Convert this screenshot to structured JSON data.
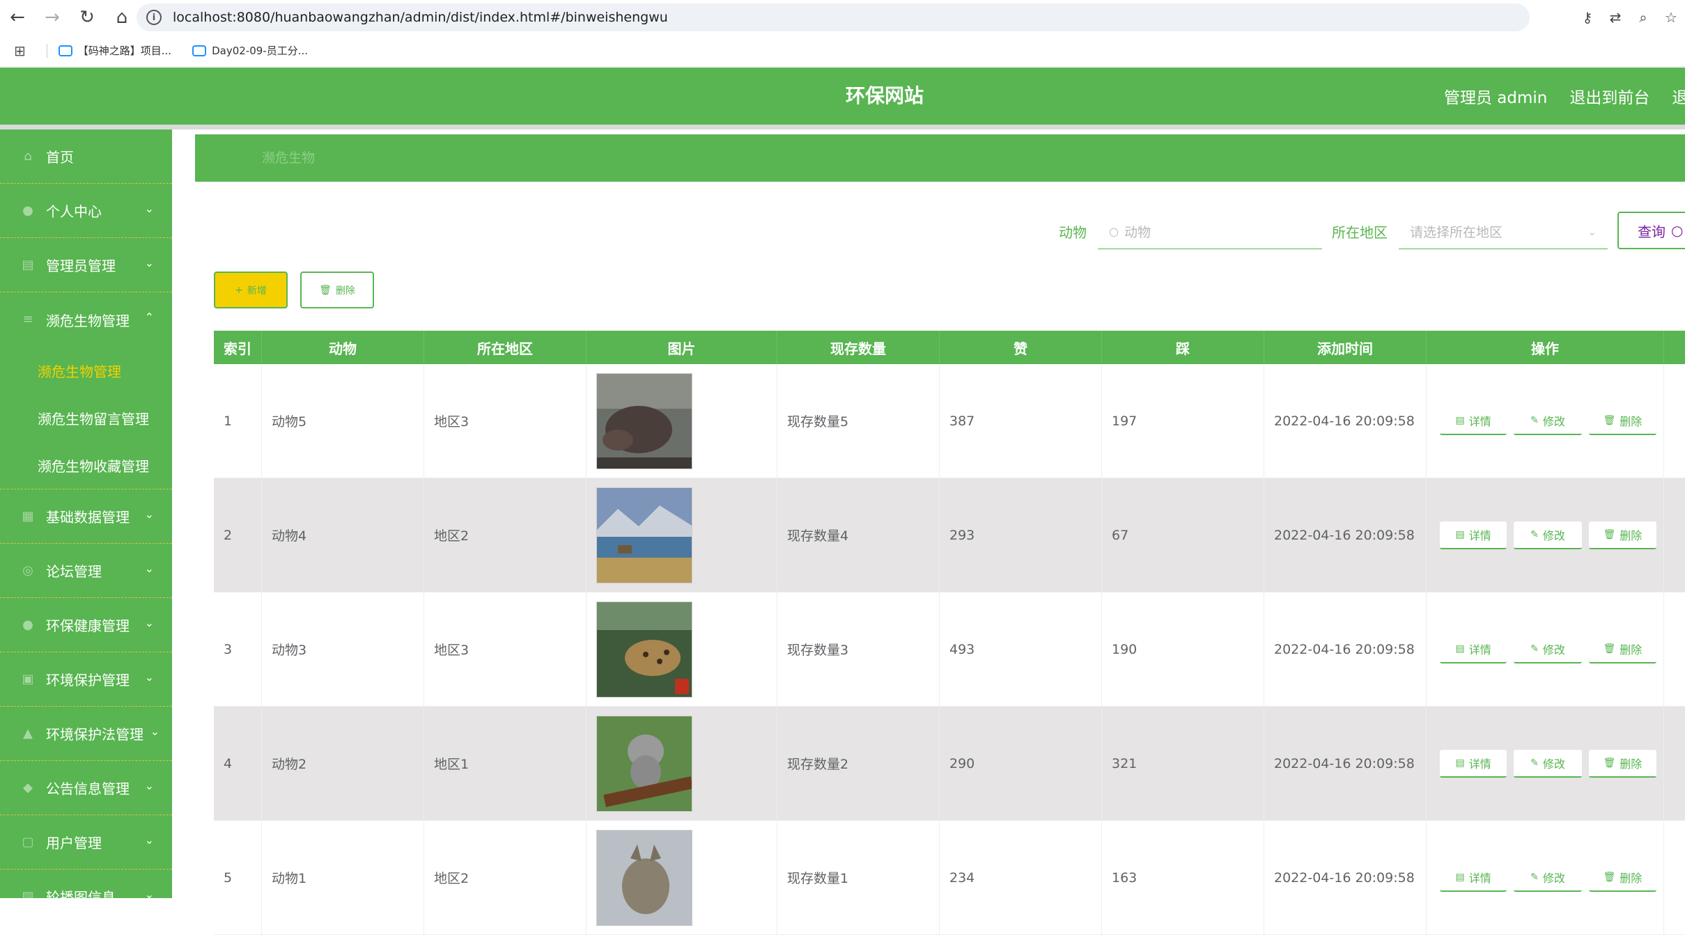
{
  "browser": {
    "url": "localhost:8080/huanbaowangzhan/admin/dist/index.html#/binweishengwu",
    "bookmarks": [
      "【码神之路】项目...",
      "Day02-09-员工分..."
    ]
  },
  "header": {
    "title": "环保网站",
    "admin_label": "管理员 admin",
    "back_label": "退出到前台",
    "logout_label": "退出登录"
  },
  "sidebar": {
    "home": "首页",
    "items": [
      {
        "label": "个人中心"
      },
      {
        "label": "管理员管理"
      },
      {
        "label": "濒危生物管理"
      },
      {
        "label": "基础数据管理"
      },
      {
        "label": "论坛管理"
      },
      {
        "label": "环保健康管理"
      },
      {
        "label": "环境保护管理"
      },
      {
        "label": "环境保护法管理"
      },
      {
        "label": "公告信息管理"
      },
      {
        "label": "用户管理"
      },
      {
        "label": "轮播图信息"
      }
    ],
    "submenu": [
      "濒危生物管理",
      "濒危生物留言管理",
      "濒危生物收藏管理"
    ]
  },
  "breadcrumb": "濒危生物",
  "search": {
    "animal_label": "动物",
    "animal_placeholder": "动物",
    "region_label": "所在地区",
    "region_placeholder": "请选择所在地区",
    "query_label": "查询"
  },
  "actions": {
    "add": "新增",
    "delete": "删除"
  },
  "table": {
    "headers": [
      "索引",
      "动物",
      "所在地区",
      "图片",
      "现存数量",
      "赞",
      "踩",
      "添加时间",
      "操作"
    ],
    "op_labels": {
      "detail": "详情",
      "edit": "修改",
      "delete": "删除"
    },
    "rows": [
      {
        "index": "1",
        "animal": "动物5",
        "region": "地区3",
        "count": "现存数量5",
        "likes": "387",
        "dislikes": "197",
        "time": "2022-04-16 20:09:58"
      },
      {
        "index": "2",
        "animal": "动物4",
        "region": "地区2",
        "count": "现存数量4",
        "likes": "293",
        "dislikes": "67",
        "time": "2022-04-16 20:09:58"
      },
      {
        "index": "3",
        "animal": "动物3",
        "region": "地区3",
        "count": "现存数量3",
        "likes": "493",
        "dislikes": "190",
        "time": "2022-04-16 20:09:58"
      },
      {
        "index": "4",
        "animal": "动物2",
        "region": "地区1",
        "count": "现存数量2",
        "likes": "290",
        "dislikes": "321",
        "time": "2022-04-16 20:09:58"
      },
      {
        "index": "5",
        "animal": "动物1",
        "region": "地区2",
        "count": "现存数量1",
        "likes": "234",
        "dislikes": "163",
        "time": "2022-04-16 20:09:58"
      }
    ]
  },
  "colors": {
    "primary": "#58b551",
    "accent": "#f5d000",
    "stripe": "#e6e4e4"
  }
}
